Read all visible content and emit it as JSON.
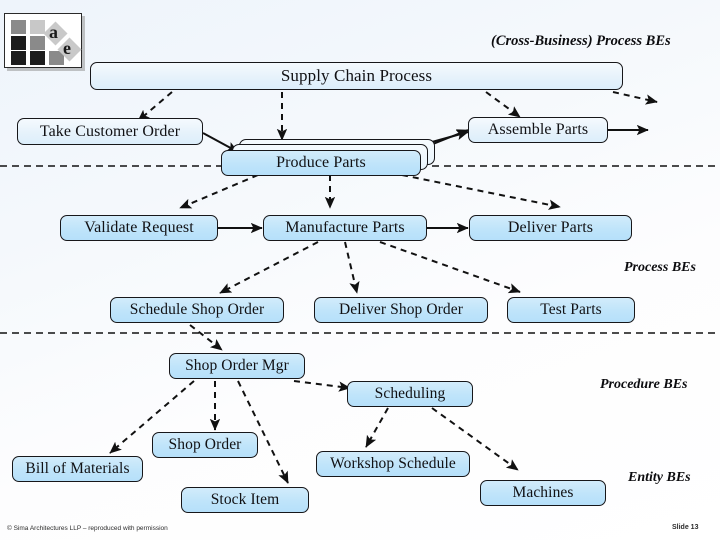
{
  "slide": {
    "title_top_right": "(Cross-Business) Process BEs",
    "footer_copyright": "© Sima Architectures LLP  – reproduced with permission",
    "slide_number": "Slide 13"
  },
  "logo": {
    "letter_a": "a",
    "letter_e": "e"
  },
  "band_labels": {
    "cross_business": "(Cross-Business) Process BEs",
    "process": "Process BEs",
    "procedure": "Procedure BEs",
    "entity": "Entity BEs"
  },
  "nodes": {
    "supply_chain_process": "Supply Chain Process",
    "take_customer_order": "Take Customer Order",
    "produce_parts": "Produce Parts",
    "assemble_parts": "Assemble Parts",
    "validate_request": "Validate Request",
    "manufacture_parts": "Manufacture Parts",
    "deliver_parts": "Deliver Parts",
    "schedule_shop_order": "Schedule Shop Order",
    "deliver_shop_order": "Deliver Shop Order",
    "test_parts": "Test Parts",
    "shop_order_mgr": "Shop Order Mgr",
    "scheduling": "Scheduling",
    "shop_order": "Shop Order",
    "bill_of_materials": "Bill of Materials",
    "stock_item": "Stock Item",
    "workshop_schedule": "Workshop Schedule",
    "machines": "Machines"
  },
  "colors": {
    "node_pale_fill": "#e6f2fb",
    "node_blue_fill": "#bfe4fa",
    "node_border": "#17171a",
    "line": "#111111",
    "background": "#f2f7fc"
  }
}
